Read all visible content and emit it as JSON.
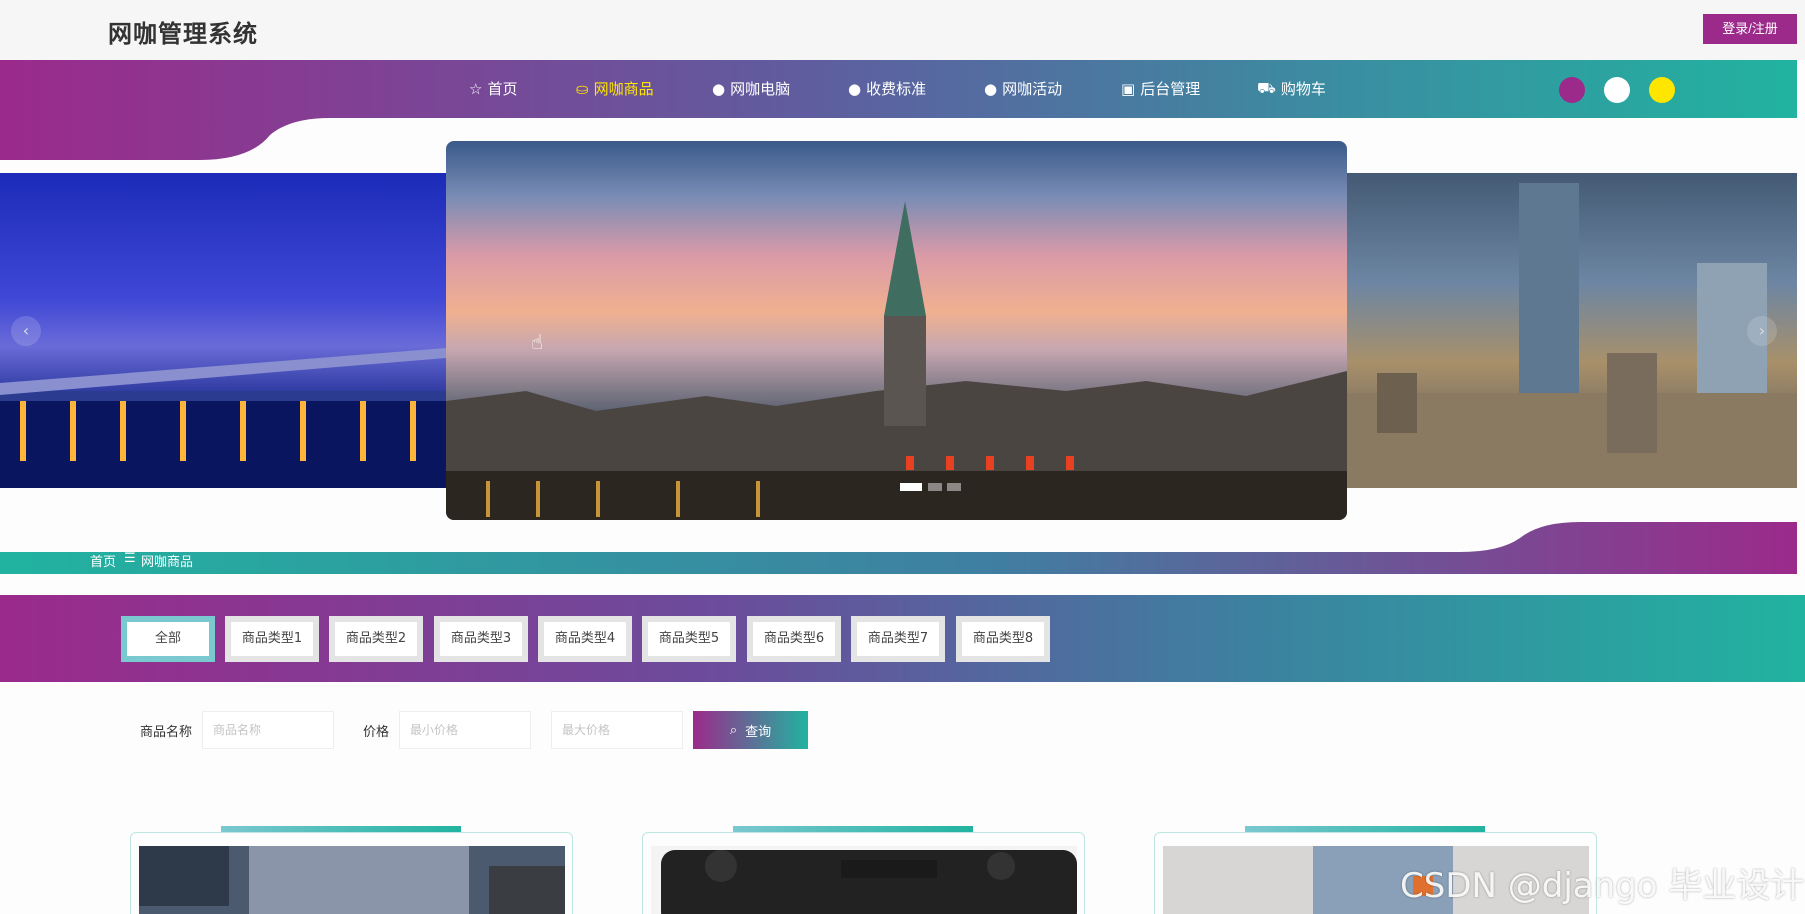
{
  "header": {
    "title": "网咖管理系统",
    "login_label": "登录/注册"
  },
  "nav": {
    "items": [
      {
        "label": "首页",
        "icon": "star-icon"
      },
      {
        "label": "网咖商品",
        "icon": "bag-icon",
        "active": true
      },
      {
        "label": "网咖电脑",
        "icon": "info-icon"
      },
      {
        "label": "收费标准",
        "icon": "info-icon"
      },
      {
        "label": "网咖活动",
        "icon": "info-icon"
      },
      {
        "label": "后台管理",
        "icon": "briefcase-icon"
      },
      {
        "label": "购物车",
        "icon": "cart-icon"
      }
    ],
    "theme_colors": [
      "#9b2a8b",
      "#ffffff",
      "#ffe600"
    ]
  },
  "carousel": {
    "prev": "‹",
    "next": "›",
    "dot_count": 3,
    "active_dot": 0
  },
  "breadcrumb": {
    "home": "首页",
    "separator": "☰",
    "current": "网咖商品"
  },
  "categories": [
    "全部",
    "商品类型1",
    "商品类型2",
    "商品类型3",
    "商品类型4",
    "商品类型5",
    "商品类型6",
    "商品类型7",
    "商品类型8"
  ],
  "search": {
    "name_label": "商品名称",
    "name_placeholder": "商品名称",
    "price_label": "价格",
    "min_placeholder": "最小价格",
    "max_placeholder": "最大价格",
    "button_label": "查询"
  },
  "watermark": "CSDN @django 毕业设计",
  "colors": {
    "primary": "#9b2a8b",
    "secondary": "#21b3a0",
    "active_nav": "#ffe600"
  }
}
